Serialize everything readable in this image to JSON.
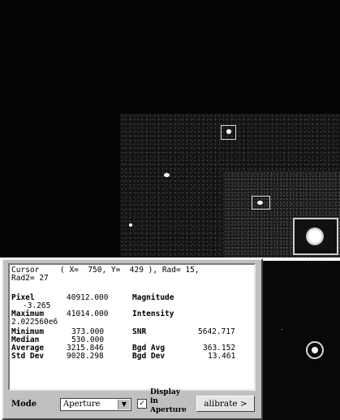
{
  "cursor": {
    "label": "Cursor",
    "coords": "( X=  750, Y=  429 ), Rad= 15,",
    "rad2": "Rad2= 27"
  },
  "stats": {
    "pixel": {
      "label": "Pixel",
      "value": "40912.000"
    },
    "magnitude": {
      "label": "Magnitude",
      "value": "-3.265"
    },
    "maximum": {
      "label": "Maximum",
      "value": "41014.000"
    },
    "intensity": {
      "label": "Intensity",
      "value": "2.022560e6"
    },
    "minimum": {
      "label": "Minimum",
      "value": "373.000"
    },
    "snr": {
      "label": "SNR",
      "value": "5642.717"
    },
    "median": {
      "label": "Median",
      "value": "530.000"
    },
    "average": {
      "label": "Average",
      "value": "3215.846"
    },
    "bgd_avg": {
      "label": "Bgd Avg",
      "value": "363.152"
    },
    "std_dev": {
      "label": "Std Dev",
      "value": "9028.298"
    },
    "bgd_dev": {
      "label": "Bgd Dev",
      "value": "13.461"
    }
  },
  "controls": {
    "mode_label": "Mode",
    "mode_value": "Aperture",
    "display_checked": true,
    "display_line1": "Display",
    "display_line2": "in",
    "display_line3": "Aperture",
    "calibrate_label": "alibrate >"
  }
}
